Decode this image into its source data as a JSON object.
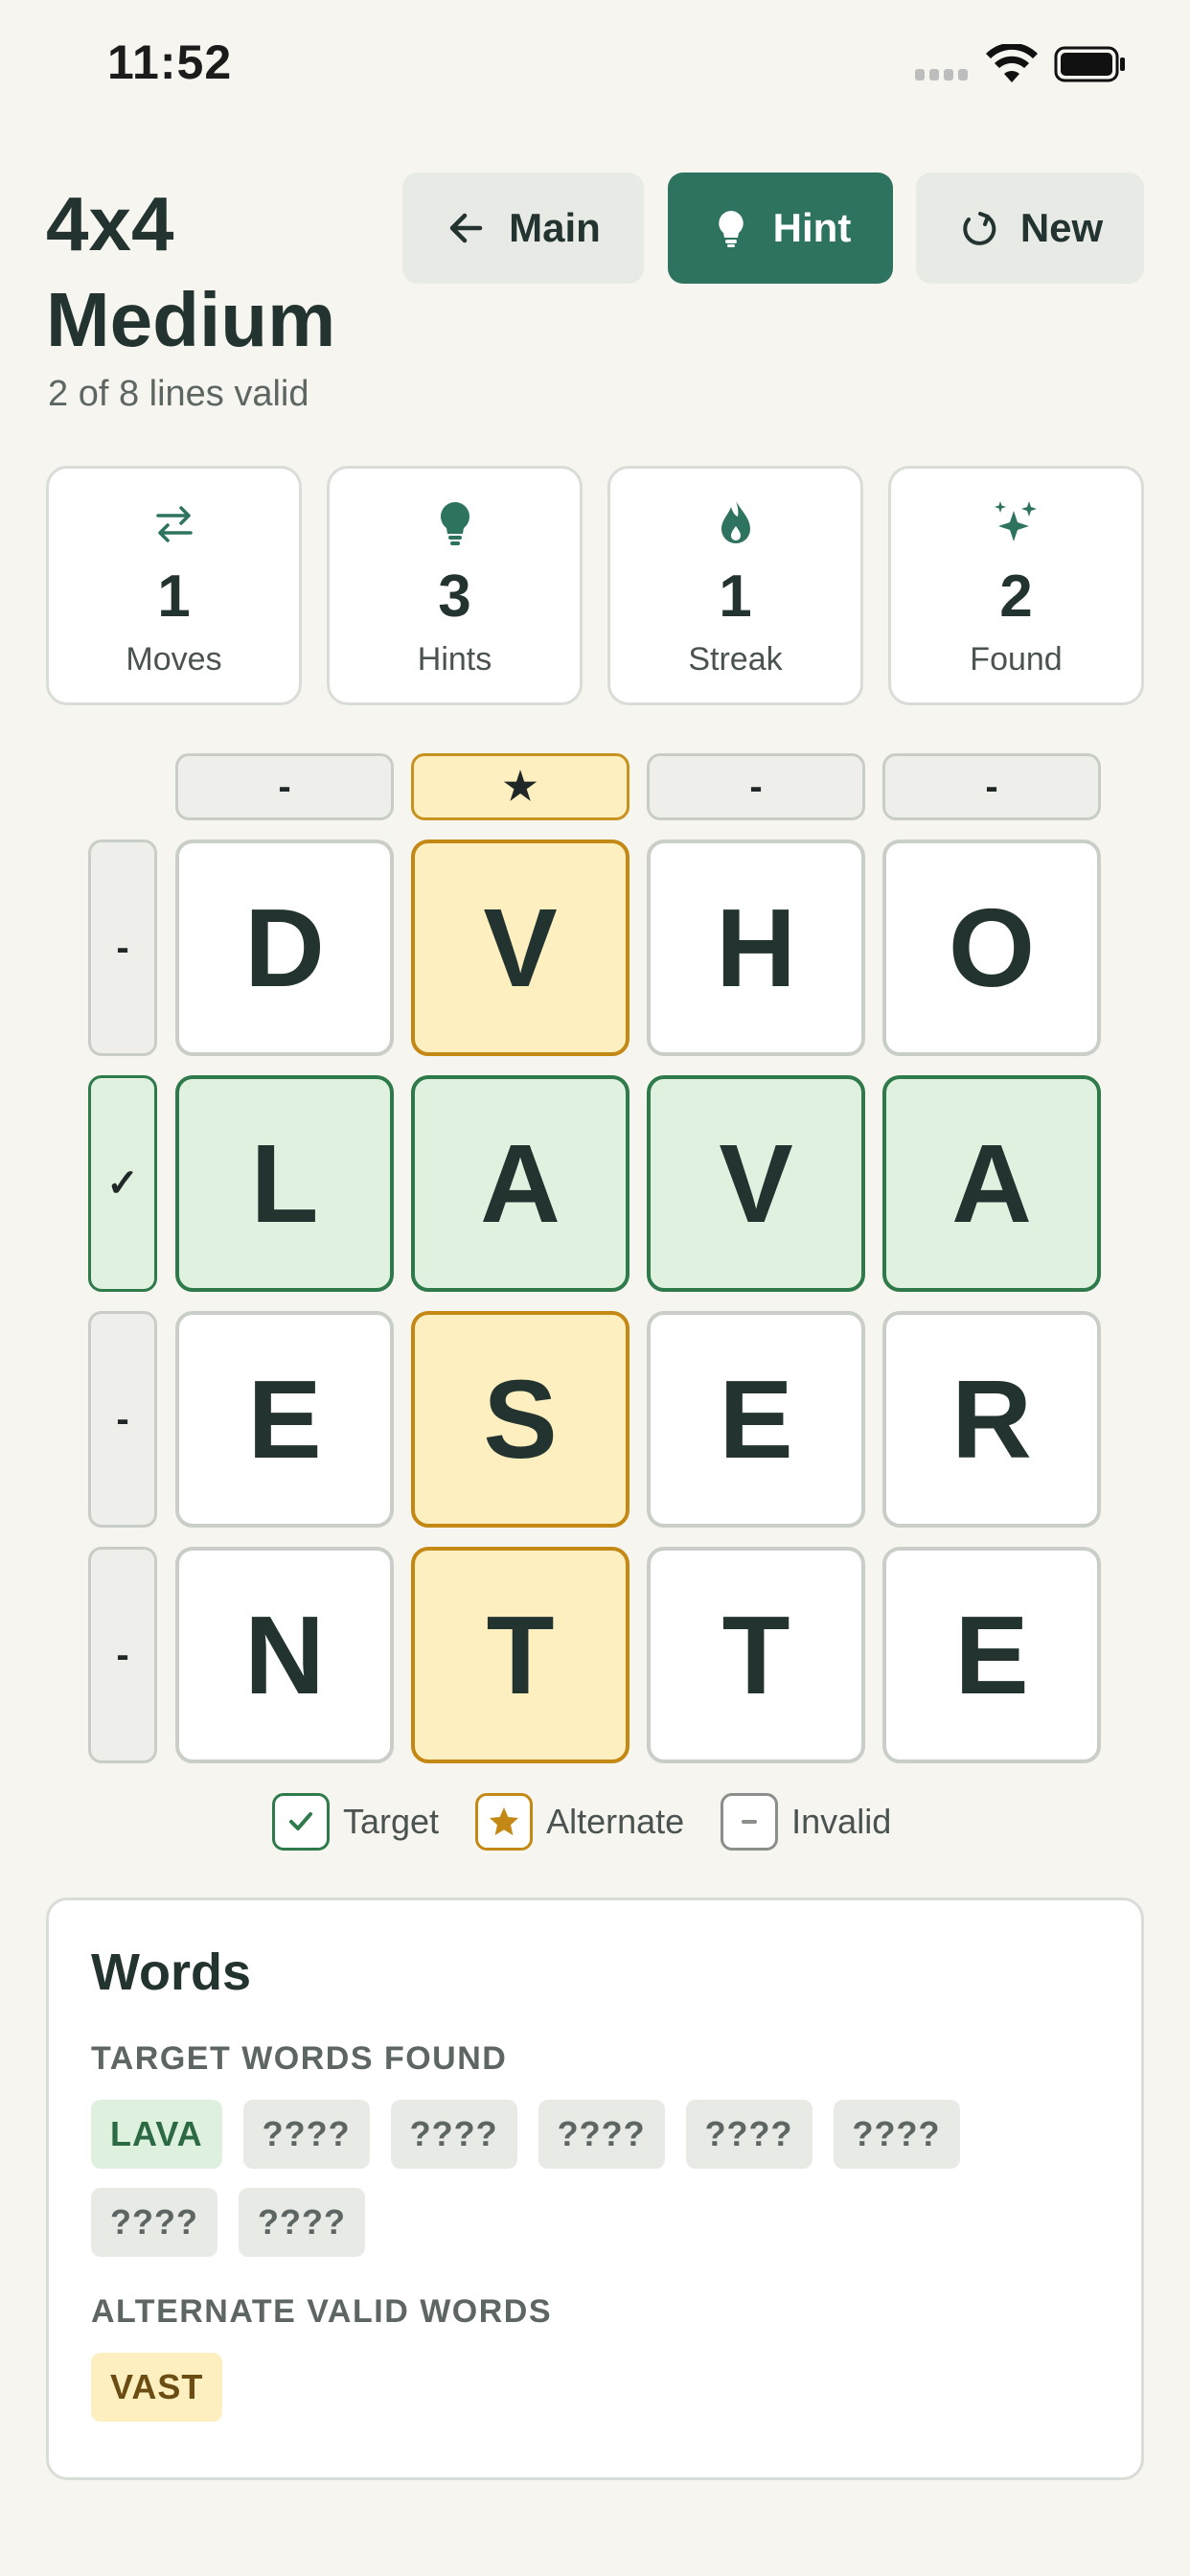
{
  "status_bar": {
    "time": "11:52"
  },
  "header": {
    "title_line1": "4x4",
    "title_line2": "Medium",
    "subtitle": "2 of 8 lines valid",
    "buttons": {
      "main": "Main",
      "hint": "Hint",
      "new": "New"
    }
  },
  "stats": [
    {
      "icon": "swap-arrows-icon",
      "value": "1",
      "label": "Moves"
    },
    {
      "icon": "lightbulb-icon",
      "value": "3",
      "label": "Hints"
    },
    {
      "icon": "flame-icon",
      "value": "1",
      "label": "Streak"
    },
    {
      "icon": "sparkles-icon",
      "value": "2",
      "label": "Found"
    }
  ],
  "grid": {
    "column_indicators": [
      "-",
      "★",
      "-",
      "-"
    ],
    "row_indicators": [
      "-",
      "✓",
      "-",
      "-"
    ],
    "rows": [
      [
        "D",
        "V",
        "H",
        "O"
      ],
      [
        "L",
        "A",
        "V",
        "A"
      ],
      [
        "E",
        "S",
        "E",
        "R"
      ],
      [
        "N",
        "T",
        "T",
        "E"
      ]
    ]
  },
  "legend": {
    "target": "Target",
    "alternate": "Alternate",
    "invalid": "Invalid"
  },
  "words": {
    "title": "Words",
    "target_label": "TARGET WORDS FOUND",
    "target_words": [
      "LAVA",
      "????",
      "????",
      "????",
      "????",
      "????",
      "????",
      "????"
    ],
    "alternate_label": "ALTERNATE VALID WORDS",
    "alternate_words": [
      "VAST"
    ]
  },
  "colors": {
    "accent": "#2e735f",
    "valid_green": "#2f7a4a",
    "alternate_gold": "#c48914",
    "background": "#f6f5f0"
  }
}
